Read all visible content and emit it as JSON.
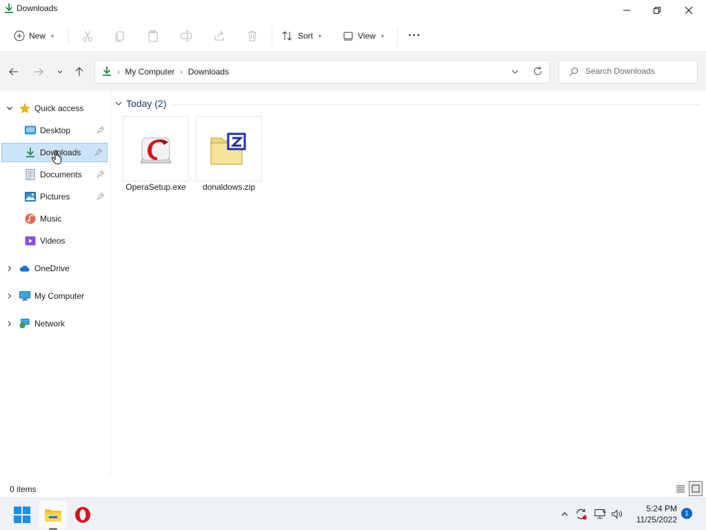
{
  "window": {
    "title": "Downloads"
  },
  "toolbar": {
    "new_label": "New",
    "sort_label": "Sort",
    "view_label": "View",
    "more_label": "···"
  },
  "address": {
    "crumbs": [
      "My Computer",
      "Downloads"
    ]
  },
  "search": {
    "placeholder": "Search Downloads"
  },
  "sidebar": {
    "quick_access": "Quick access",
    "quick_items": [
      {
        "label": "Desktop",
        "icon": "desktop-icon",
        "pinned": true
      },
      {
        "label": "Downloads",
        "icon": "download-icon",
        "pinned": true,
        "selected": true
      },
      {
        "label": "Documents",
        "icon": "documents-icon",
        "pinned": true
      },
      {
        "label": "Pictures",
        "icon": "pictures-icon",
        "pinned": true
      },
      {
        "label": "Music",
        "icon": "music-icon",
        "pinned": false
      },
      {
        "label": "Videos",
        "icon": "videos-icon",
        "pinned": false
      }
    ],
    "roots": [
      {
        "label": "OneDrive",
        "icon": "onedrive-icon"
      },
      {
        "label": "My Computer",
        "icon": "computer-icon"
      },
      {
        "label": "Network",
        "icon": "network-icon"
      }
    ]
  },
  "content": {
    "group_label": "Today (2)",
    "files": [
      {
        "name": "OperaSetup.exe",
        "icon": "opera-setup-icon"
      },
      {
        "name": "donaldows.zip",
        "icon": "zip-folder-icon"
      }
    ]
  },
  "status": {
    "items_text": "0 items"
  },
  "taskbar": {
    "time": "5:24 PM",
    "date": "11/25/2022",
    "notifications": "1"
  },
  "colors": {
    "accent": "#0a64c8",
    "selection": "#cce4f7",
    "download_green": "#1a8a4a",
    "opera_red": "#d6141f"
  }
}
